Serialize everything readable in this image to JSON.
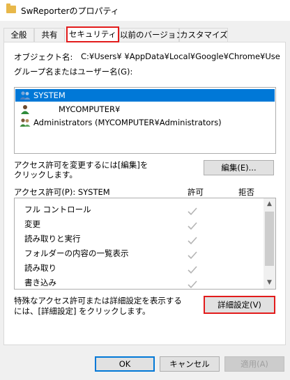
{
  "window": {
    "title": "SwReporterのプロパティ",
    "folder_icon": "folder-icon"
  },
  "tabs": [
    {
      "label": "全般"
    },
    {
      "label": "共有"
    },
    {
      "label": "セキュリティ"
    },
    {
      "label": "以前のバージョン"
    },
    {
      "label": "カスタマイズ"
    }
  ],
  "security": {
    "object_name_label": "オブジェクト名:",
    "object_name_value": "C:¥Users¥         ¥AppData¥Local¥Google¥Chrome¥Use",
    "group_label": "グループ名またはユーザー名(G):",
    "users": [
      {
        "name": "SYSTEM",
        "icon": "users-group-icon"
      },
      {
        "name": "MYCOMPUTER¥",
        "icon": "user-icon"
      },
      {
        "name": "Administrators (MYCOMPUTER¥Administrators)",
        "icon": "users-group-icon"
      }
    ],
    "change_hint_line1": "アクセス許可を変更するには[編集]を",
    "change_hint_line2": "クリックします。",
    "edit_button": "編集(E)...",
    "perm_header": "アクセス許可(P): SYSTEM",
    "allow_header": "許可",
    "deny_header": "拒否",
    "permissions": [
      {
        "name": "フル コントロール"
      },
      {
        "name": "変更"
      },
      {
        "name": "読み取りと実行"
      },
      {
        "name": "フォルダーの内容の一覧表示"
      },
      {
        "name": "読み取り"
      },
      {
        "name": "書き込み"
      }
    ],
    "advanced_hint_line1": "特殊なアクセス許可または詳細設定を表示する",
    "advanced_hint_line2": "には、[詳細設定] をクリックします。",
    "advanced_button": "詳細設定(V)"
  },
  "footer": {
    "ok": "OK",
    "cancel": "キャンセル",
    "apply": "適用(A)"
  },
  "colors": {
    "accent": "#0078d7",
    "highlight_border": "#e21b1b",
    "check": "#b4b4b4"
  }
}
